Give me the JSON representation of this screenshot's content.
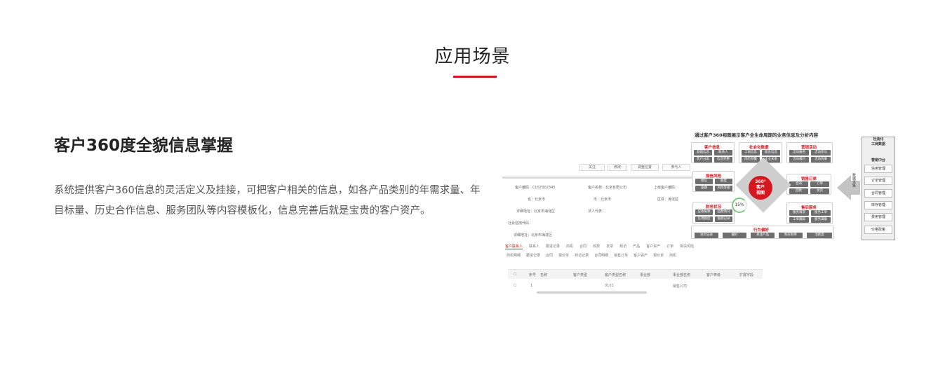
{
  "section": {
    "title": "应用场景"
  },
  "feature": {
    "title": "客户360度全貌信息掌握",
    "description": "系统提供客户360信息的灵活定义及挂接，可把客户相关的信息，如各产品类别的年需求量、年目标量、历史合作信息、服务团队等内容模板化，信息完善后就是宝贵的客户资产。"
  },
  "illustration": {
    "caption": "通过客户360视图展示客户全生命周期的业务信息及分析内容",
    "toolbar": [
      "关注",
      "修改",
      "调整位置",
      "参与人"
    ],
    "fields": {
      "code_label": "客户编码：CUST002345",
      "name_label": "客户名称：北京有限公司",
      "parent_label": "上级客户编码：",
      "province_label": "省：北京市",
      "city_label": "市：北京市",
      "district_label": "区县：海淀区",
      "address_label": "详细地址：北京市海淀区",
      "legal_label": "法人代表：",
      "social_label": "社会信用代码：",
      "detail_label": "详细地址：北京市海淀区"
    },
    "tabs": [
      "客户联系人",
      "联系人",
      "跟进记录",
      "商机",
      "合同",
      "收款",
      "发票",
      "拜访",
      "产品",
      "客户资产",
      "订单",
      "相关风险"
    ],
    "subtabs": [
      "商机明细",
      "跟进记录",
      "合同",
      "报价单",
      "拜访记录",
      "合同明细",
      "销售订单",
      "客户资产",
      "报价单",
      "商机"
    ],
    "table_headers": [
      "序号",
      "名称",
      "客户类型",
      "客户类型名称",
      "事业部",
      "事业部名称",
      "客户等级",
      "扩展字段"
    ],
    "table_row": [
      "1",
      "",
      "",
      "0101",
      "",
      "销售公司",
      "",
      ""
    ],
    "hub": {
      "line1": "360°",
      "line2": "客户",
      "line3": "视图"
    },
    "ring_value": "15%",
    "cards": [
      {
        "title": "客户信息",
        "chips": [
          "基础信息",
          "联系人",
          "客户分类",
          "信息完整"
        ]
      },
      {
        "title": "社会化数据",
        "chips": [
          "工商信息",
          "股东信息",
          "风险预警",
          "企业关系"
        ]
      },
      {
        "title": "营销活动",
        "chips": [
          "活动报名",
          "活动参与",
          "活动邀约",
          "活动效果"
        ]
      },
      {
        "title": "授信风险",
        "chips": [
          "授信",
          "额度",
          "逾期",
          "风险等级"
        ]
      },
      {
        "title": "销售订单",
        "chips": [
          "合同",
          "订单",
          "回款",
          "发货"
        ]
      },
      {
        "title": "财务状况",
        "chips": [
          "应收账款",
          "回款情况",
          "信用额度",
          "逾期记录"
        ]
      },
      {
        "title": "售后服务",
        "chips": [
          "服务请求",
          "服务工单",
          "工单跟踪",
          "服务满意"
        ]
      },
      {
        "title": "行为偏好",
        "chips": [
          "访问记录",
          "偏好",
          "关注产品",
          "购买频率",
          "活跃度"
        ]
      }
    ],
    "side_label": "数据采集",
    "right_panel": {
      "header_line1": "社会化",
      "header_line2": "工商数据",
      "sub_header": "营销中台",
      "items": [
        "信用管理",
        "订单管理",
        "合同管理",
        "库存管理",
        "费用管理",
        "价格政策"
      ]
    }
  }
}
